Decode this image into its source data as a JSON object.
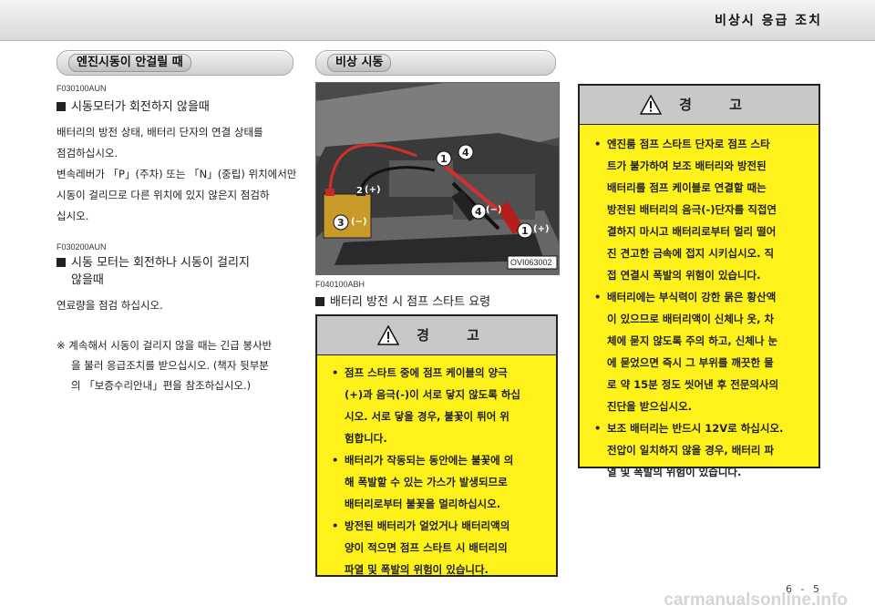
{
  "header": {
    "title": "비상시 응급 조치"
  },
  "left": {
    "pill_label": "엔진시동이 안걸릴 때",
    "sec1": {
      "code": "F030100AUN",
      "heading": "시동모터가 회전하지 않을때",
      "lines": [
        "배터리의 방전 상태, 배터리 단자의 연결 상태를",
        "점검하십시오.",
        "변속레버가 「P」(주차) 또는 「N」(중립) 위치에서만",
        "시동이 걸리므로 다른 위치에 있지 않은지 점검하",
        "십시오."
      ]
    },
    "sec2": {
      "code": "F030200AUN",
      "heading_line1": "시동 모터는 회전하나 시동이 걸리지",
      "heading_line2": "않을때",
      "line": "연료량을 점검 하십시오.",
      "note_lines": [
        "※ 계속해서 시동이 걸리지 않을 때는 긴급 봉사반",
        "을 불러 응급조치를 받으십시오. (책자 뒷부분",
        "의 「보증수리안내」편을 참조하십시오.)"
      ]
    }
  },
  "middle": {
    "pill_label": "비상 시동",
    "image_code": "OVI063002",
    "labels": {
      "n1": "1",
      "n2": "2",
      "n3": "3",
      "n4": "4",
      "plus": "(+)",
      "minus": "(−)"
    },
    "code": "F040100ABH",
    "heading": "배터리 방전 시 점프 스타트 요령",
    "warning": {
      "title": "경 고",
      "items": [
        {
          "lines": [
            "점프 스타트 중에 점프 케이블의 양극",
            "(+)과 음극(-)이 서로 닿지 않도록 하십",
            "시오. 서로 닿을 경우, 불꽃이 튀어 위",
            "험합니다."
          ]
        },
        {
          "lines": [
            "배터리가 작동되는 동안에는 불꽃에 의",
            "해 폭발할 수 있는 가스가 발생되므로",
            "배터리로부터 불꽃을 멀리하십시오."
          ]
        },
        {
          "lines": [
            "방전된 배터리가 얼었거나 배터리액의",
            "양이 적으면 점프 스타트 시 배터리의",
            "파열 및 폭발의 위험이 있습니다."
          ]
        }
      ]
    }
  },
  "right": {
    "warning": {
      "title": "경 고",
      "items": [
        {
          "lines": [
            "엔진룸 점프 스타트 단자로 점프 스타",
            "트가 불가하여 보조 배터리와 방전된",
            "배터리를 점프 케이블로 연결할 때는",
            "방전된 배터리의 음극(-)단자를 직접연",
            "결하지 마시고 배터리로부터 멀리 떨어",
            "진 견고한 금속에 접지 시키십시오. 직",
            "접 연결시 폭발의 위험이 있습니다."
          ]
        },
        {
          "lines": [
            "배터리에는 부식력이 강한 묽은 황산액",
            "이 있으므로 배터리액이 신체나 옷, 차",
            "체에 묻지 않도록 주의 하고, 신체나 눈",
            "에 묻었으면 즉시 그 부위를 깨끗한 물",
            "로 약 15분 정도 씻어낸 후 전문의사의",
            "진단을 받으십시오."
          ]
        },
        {
          "lines": [
            "보조 배터리는 반드시 12V로 하십시오.",
            "전압이 일치하지 않을 경우, 배터리 파",
            "열 및 폭발의 위험이 있습니다."
          ]
        }
      ]
    }
  },
  "footer": {
    "page": "6 - 5",
    "watermark": "carmanualsonline.info"
  }
}
